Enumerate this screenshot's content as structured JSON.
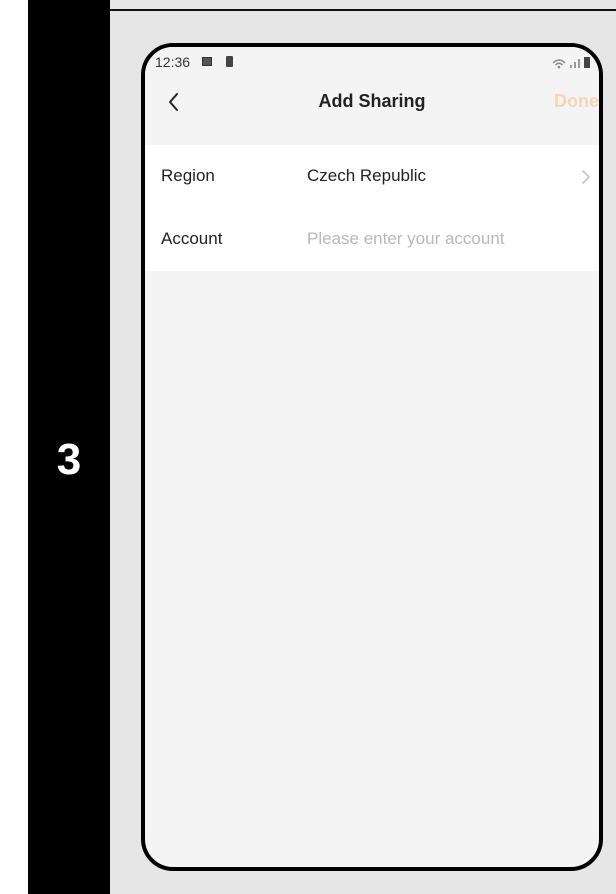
{
  "step": {
    "number": "3"
  },
  "status_bar": {
    "time": "12:36",
    "icons": [
      "image-icon",
      "battery-icon",
      "wifi-icon",
      "signal-icon"
    ]
  },
  "nav": {
    "back_icon": "chevron-left-icon",
    "title": "Add Sharing",
    "done_label": "Done",
    "done_color": "#f6d4b4"
  },
  "form": {
    "region": {
      "label": "Region",
      "value": "Czech Republic",
      "icon": "chevron-right-icon"
    },
    "account": {
      "label": "Account",
      "value": "",
      "placeholder": "Please enter your account"
    }
  },
  "colors": {
    "step_bar": "#000000",
    "panel_bg": "#e6e6e6",
    "screen_bg": "#f4f4f4",
    "list_bg": "#ffffff"
  }
}
